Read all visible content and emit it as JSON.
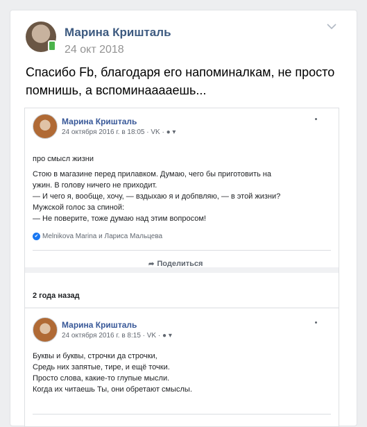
{
  "post": {
    "author": "Марина Кришталь",
    "date": "24 окт 2018",
    "text": "Спасибо Fb, благодаря его напоминалкам, не просто помнишь, а вспоминааааешь...",
    "menu_icon": "chevron-down-icon"
  },
  "embed": {
    "first": {
      "author": "Марина Кришталь",
      "meta": "24 октября 2016 г. в 18:05 · VK ·",
      "lines": [
        "про смысл жизни",
        "Стою в магазине перед прилавком. Думаю, чего бы приготовить на",
        "ужин. В голову ничего не приходит.",
        "— И чего я, вообще, хочу, — вздыхаю я и добпвляю, — в этой жизни?",
        "Мужской голос за спиной:",
        "— Не поверите, тоже думаю над этим вопросом!"
      ],
      "likes": "Melnikova Marina и Лариса Мальцева",
      "share": "Поделиться"
    },
    "ago": "2 года назад",
    "second": {
      "author": "Марина Кришталь",
      "meta": "24 октября 2016 г. в 8:15 · VK ·",
      "lines": [
        "Буквы и буквы, строчки да строчки,",
        "Средь них запятые, тире, и ещё точки.",
        "Просто слова, какие-то глупые мысли.",
        "Когда их читаешь Ты, они обретают смыслы."
      ]
    }
  }
}
